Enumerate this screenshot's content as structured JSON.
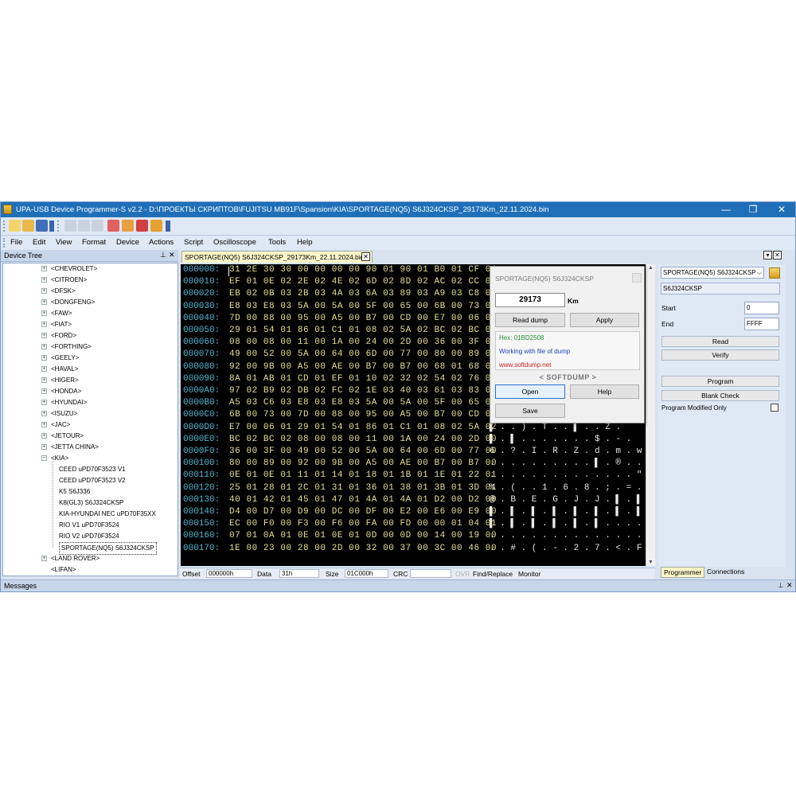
{
  "window": {
    "title": "UPA-USB Device Programmer-S v2.2 - D:\\ПРОЕКТЫ СКРИПТОВ\\FUJITSU MB91F\\Spansion\\KIA\\SPORTAGE(NQ5) S6J324CKSP_29173Km_22.11.2024.bin",
    "minimize": "—",
    "maximize": "❐",
    "close": "✕"
  },
  "menu": [
    "File",
    "Edit",
    "View",
    "Format",
    "Device",
    "Actions",
    "Script",
    "Oscilloscope",
    "Tools",
    "Help"
  ],
  "device_tree": {
    "header": "Device Tree",
    "pin": "⊥",
    "close": "✕",
    "items": [
      {
        "label": "<CHEVROLET>",
        "type": "collapsed"
      },
      {
        "label": "<CITROEN>",
        "type": "collapsed"
      },
      {
        "label": "<DFSK>",
        "type": "collapsed"
      },
      {
        "label": "<DONGFENG>",
        "type": "collapsed"
      },
      {
        "label": "<FAW>",
        "type": "collapsed"
      },
      {
        "label": "<FIAT>",
        "type": "collapsed"
      },
      {
        "label": "<FORD>",
        "type": "collapsed"
      },
      {
        "label": "<FORTHING>",
        "type": "collapsed"
      },
      {
        "label": "<GEELY>",
        "type": "collapsed"
      },
      {
        "label": "<HAVAL>",
        "type": "collapsed"
      },
      {
        "label": "<HIGER>",
        "type": "collapsed"
      },
      {
        "label": "<HONDA>",
        "type": "collapsed"
      },
      {
        "label": "<HYUNDAI>",
        "type": "collapsed"
      },
      {
        "label": "<ISUZU>",
        "type": "collapsed"
      },
      {
        "label": "<JAC>",
        "type": "collapsed"
      },
      {
        "label": "<JETOUR>",
        "type": "collapsed"
      },
      {
        "label": "<JETTA CHINA>",
        "type": "collapsed"
      },
      {
        "label": "<KIA>",
        "type": "expanded"
      },
      {
        "label": "CEED uPD70F3523 V1",
        "type": "child"
      },
      {
        "label": "CEED uPD70F3523 V2",
        "type": "child"
      },
      {
        "label": "K5 S6J336",
        "type": "child"
      },
      {
        "label": "K8(GL3) S6J324CKSP",
        "type": "child"
      },
      {
        "label": "KIA-HYUNDAI NEC uPD70F35XX",
        "type": "child"
      },
      {
        "label": "RIO V1 uPD70F3524",
        "type": "child"
      },
      {
        "label": "RIO V2 uPD70F3524",
        "type": "child"
      },
      {
        "label": "SPORTAGE(NQ5) S6J324CKSP",
        "type": "child-selected"
      },
      {
        "label": "<LAND ROVER>",
        "type": "collapsed"
      },
      {
        "label": "<LIFAN>",
        "type": "leaf"
      }
    ]
  },
  "tab": {
    "label": "SPORTAGE(NQ5) S6J324CKSP_29173Km_22.11.2024.bin",
    "close": "✕"
  },
  "hex": {
    "rows": [
      {
        "addr": "000000:",
        "bytes": "31 2E 30 30 00 00 00 00 90 01 90 01 B0 01 CF 01",
        "ascii": ""
      },
      {
        "addr": "000010:",
        "bytes": "EF 01 0E 02 2E 02 4E 02 6D 02 8D 02 AC 02 CC 02",
        "ascii": ""
      },
      {
        "addr": "000020:",
        "bytes": "EB 02 0B 03 2B 03 4A 03 6A 03 89 03 A9 03 C8 03",
        "ascii": ""
      },
      {
        "addr": "000030:",
        "bytes": "E8 03 E8 03 5A 00 5A 00 5F 00 65 00 6B 00 73 00",
        "ascii": ""
      },
      {
        "addr": "000040:",
        "bytes": "7D 00 88 00 95 00 A5 00 B7 00 CD 00 E7 00 06 01",
        "ascii": ""
      },
      {
        "addr": "000050:",
        "bytes": "29 01 54 01 86 01 C1 01 08 02 5A 02 BC 02 BC 02",
        "ascii": ""
      },
      {
        "addr": "000060:",
        "bytes": "08 00 08 00 11 00 1A 00 24 00 2D 00 36 00 3F 00",
        "ascii": ""
      },
      {
        "addr": "000070:",
        "bytes": "49 00 52 00 5A 00 64 00 6D 00 77 00 80 00 89 00",
        "ascii": ""
      },
      {
        "addr": "000080:",
        "bytes": "92 00 9B 00 A5 00 AE 00 B7 00 B7 00 68 01 68 01",
        "ascii": ""
      },
      {
        "addr": "000090:",
        "bytes": "8A 01 AB 01 CD 01 EF 01 10 02 32 02 54 02 76 02",
        "ascii": ""
      },
      {
        "addr": "0000A0:",
        "bytes": "97 02 B9 02 DB 02 FC 02 1E 03 40 03 61 03 83 03",
        "ascii": ""
      },
      {
        "addr": "0000B0:",
        "bytes": "A5 03 C6 03 E8 03 E8 03 5A 00 5A 00 5F 00 65 00",
        "ascii": ""
      },
      {
        "addr": "0000C0:",
        "bytes": "6B 00 73 00 7D 00 88 00 95 00 A5 00 B7 00 CD 00",
        "ascii": ""
      },
      {
        "addr": "0000D0:",
        "bytes": "E7 00 06 01 29 01 54 01 86 01 C1 01 08 02 5A 02",
        "ascii": "▌ .  .  ) . T .  .  ▌ .  .  Z ."
      },
      {
        "addr": "0000E0:",
        "bytes": "BC 02 BC 02 08 00 08 00 11 00 1A 00 24 00 2D 00",
        "ascii": "▌ .  ▌ .  .  .  .  .  .  .  $ .  - ."
      },
      {
        "addr": "0000F0:",
        "bytes": "36 00 3F 00 49 00 52 00 5A 00 64 00 6D 00 77 00",
        "ascii": "6 . ? . I . R . Z . d . m . w ."
      },
      {
        "addr": "000100:",
        "bytes": "80 00 89 00 92 00 9B 00 A5 00 AE 00 B7 00 B7 00",
        "ascii": ".  .  .  .  .  .  .  .  .  .  ▌ . ® .  .  ."
      },
      {
        "addr": "000110:",
        "bytes": "0E 01 0E 01 11 01 14 01 18 01 1B 01 1E 01 22 01",
        "ascii": ".  .  .  .  .  .  .  .  .  .  .  .  .  .  \" ."
      },
      {
        "addr": "000120:",
        "bytes": "25 01 28 01 2C 01 31 01 36 01 38 01 3B 01 3D 01",
        "ascii": "% . ( .  . 1 . 6 . 8 . ; . = ."
      },
      {
        "addr": "000130:",
        "bytes": "40 01 42 01 45 01 47 01 4A 01 4A 01 D2 00 D2 00",
        "ascii": "@ . B . E . G . J . J . ▌ . ▌ ."
      },
      {
        "addr": "000140:",
        "bytes": "D4 00 D7 00 D9 00 DC 00 DF 00 E2 00 E6 00 E9 00",
        "ascii": "▌ . ▌ . ▌ . ▌ . ▌ . ▌ . ▌ . ▌ ."
      },
      {
        "addr": "000150:",
        "bytes": "EC 00 F0 00 F3 00 F6 00 FA 00 FD 00 00 01 04 01",
        "ascii": "▌ . ▌ . ▌ . ▌ . ▌ . ▌ .  .  .  ."
      },
      {
        "addr": "000160:",
        "bytes": "07 01 0A 01 0E 01 0E 01 0D 00 0D 00 14 00 19 00",
        "ascii": ".  .  .  .  .  .  .  .  .  .  .  .  .  .  .  ."
      },
      {
        "addr": "000170:",
        "bytes": "1E 00 23 00 28 00 2D 00 32 00 37 00 3C 00 46 00",
        "ascii": ". . # . ( . - . 2 . 7 . < . F ."
      }
    ]
  },
  "status": {
    "offset_label": "Offset",
    "offset_value": "000000h",
    "data_label": "Data",
    "data_value": "31h",
    "size_label": "Size",
    "size_value": "01C000h",
    "crc_label": "CRC",
    "crc_value": "",
    "ovr": "OVR",
    "find": "Find/Replace",
    "monitor": "Monitor"
  },
  "popup": {
    "title": "SPORTAGE(NQ5) S6J324CKSP",
    "km_value": "29173",
    "km_label": "Km",
    "read_dump": "Read dump",
    "apply": "Apply",
    "hex": "Hex: 01BD2508",
    "working": "Working with file of dump",
    "site": "www.softdump.net",
    "brand": "< SOFTDUMP >",
    "open": "Open",
    "help": "Help",
    "save": "Save"
  },
  "programmer": {
    "device_select": "SPORTAGE(NQ5) S6J324CKSP",
    "device_name": "S6J324CKSP",
    "start_label": "Start",
    "start_value": "0",
    "end_label": "End",
    "end_value": "FFFF",
    "read": "Read",
    "verify": "Verify",
    "modified_only": "Program Modified Only",
    "program": "Program",
    "blank_check": "Blank Check",
    "tabs": [
      "Programmer",
      "Connections"
    ]
  },
  "messages": {
    "header": "Messages",
    "pin": "⊥",
    "close": "✕"
  },
  "colors": {
    "titlebar": "#1f6fb8",
    "hex_background": "#000000",
    "hex_address": "#52b7d4",
    "hex_bytes": "#e5e090",
    "panel": "#dfe8f5"
  }
}
